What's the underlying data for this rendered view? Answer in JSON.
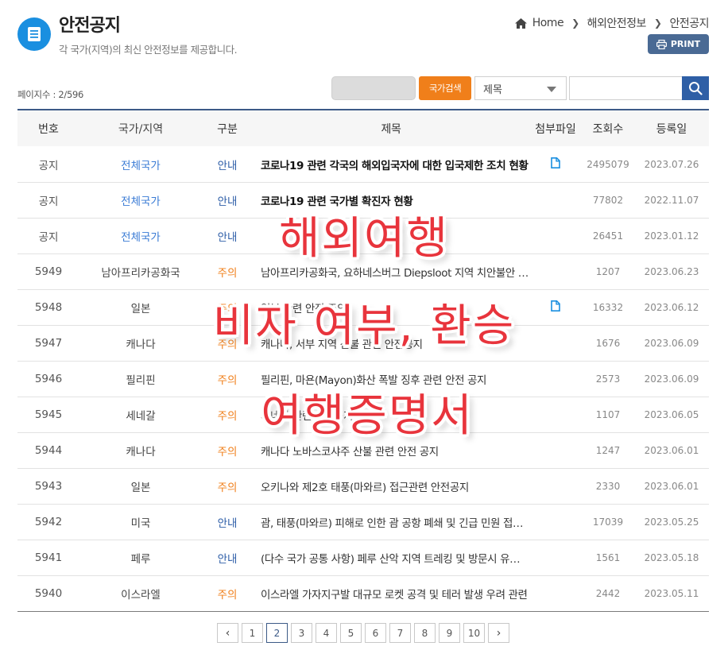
{
  "header": {
    "title": "안전공지",
    "subtitle": "각 국가(지역)의 최신 안전정보를 제공합니다.",
    "breadcrumb": [
      "Home",
      "해외안전정보",
      "안전공지"
    ],
    "print_label": "PRINT"
  },
  "search": {
    "page_count": "페이지수 : 2/596",
    "country_search_label": "국가검색",
    "field_select_value": "제목",
    "keyword_value": ""
  },
  "table": {
    "headers": {
      "no": "번호",
      "country": "국가/지역",
      "type": "구분",
      "title": "제목",
      "file": "첨부파일",
      "views": "조회수",
      "date": "등록일"
    },
    "rows": [
      {
        "no": "공지",
        "country": "전체국가",
        "type": "안내",
        "title": "코로나19 관련 각국의 해외입국자에 대한 입국제한 조치 현황",
        "views": "2495079",
        "date": "2023.07.26",
        "file": true,
        "bold": true
      },
      {
        "no": "공지",
        "country": "전체국가",
        "type": "안내",
        "title": "코로나19 관련 국가별 확진자 현황",
        "views": "77802",
        "date": "2022.11.07",
        "file": false,
        "bold": true
      },
      {
        "no": "공지",
        "country": "전체국가",
        "type": "안내",
        "title": "",
        "views": "26451",
        "date": "2023.01.12",
        "file": false,
        "bold": true
      },
      {
        "no": "5949",
        "country": "남아프리카공화국",
        "type": "주의",
        "title": "남아프리카공화국, 요하네스버그 Diepsloot 지역 치안불안 관련",
        "views": "1207",
        "date": "2023.06.23",
        "file": false,
        "bold": false
      },
      {
        "no": "5948",
        "country": "일본",
        "type": "주의",
        "title": "일본 관련 안전 주의",
        "views": "16332",
        "date": "2023.06.12",
        "file": true,
        "bold": false
      },
      {
        "no": "5947",
        "country": "캐나다",
        "type": "주의",
        "title": "캐나다, 서부 지역 산불 관련 안전공지",
        "views": "1676",
        "date": "2023.06.09",
        "file": false,
        "bold": false
      },
      {
        "no": "5946",
        "country": "필리핀",
        "type": "주의",
        "title": "필리핀, 마욘(Mayon)화산 폭발 징후 관련 안전 공지",
        "views": "2573",
        "date": "2023.06.09",
        "file": false,
        "bold": false
      },
      {
        "no": "5945",
        "country": "세네갈",
        "type": "주의",
        "title": "세네갈 관련 안전공지",
        "views": "1107",
        "date": "2023.06.05",
        "file": false,
        "bold": false
      },
      {
        "no": "5944",
        "country": "캐나다",
        "type": "주의",
        "title": "캐나다 노바스코샤주 산불 관련 안전 공지",
        "views": "1247",
        "date": "2023.06.01",
        "file": false,
        "bold": false
      },
      {
        "no": "5943",
        "country": "일본",
        "type": "주의",
        "title": "오키나와 제2호 태풍(마와르) 접근관련 안전공지",
        "views": "2330",
        "date": "2023.06.01",
        "file": false,
        "bold": false
      },
      {
        "no": "5942",
        "country": "미국",
        "type": "안내",
        "title": "괌, 태풍(마와르) 피해로 인한 괌 공항 폐쇄 및 긴급 민원 접수 안내",
        "views": "17039",
        "date": "2023.05.25",
        "file": false,
        "bold": false
      },
      {
        "no": "5941",
        "country": "페루",
        "type": "안내",
        "title": "(다수 국가 공통 사항) 페루 산악 지역 트레킹 및 방문시 유의사항",
        "views": "1561",
        "date": "2023.05.18",
        "file": false,
        "bold": false
      },
      {
        "no": "5940",
        "country": "이스라엘",
        "type": "주의",
        "title": "이스라엘 가자지구발 대규모 로켓 공격 및 테러 발생 우려 관련",
        "views": "2442",
        "date": "2023.05.11",
        "file": false,
        "bold": false
      }
    ]
  },
  "pagination": {
    "pages": [
      "1",
      "2",
      "3",
      "4",
      "5",
      "6",
      "7",
      "8",
      "9",
      "10"
    ],
    "current": "2",
    "prev": "‹",
    "next": "›"
  },
  "overlay": {
    "line1": "해외여행",
    "line2": "비자 여부, 환승",
    "line3": "여행증명서"
  },
  "colors": {
    "accent_blue": "#1a8fe0",
    "navy": "#3c5a87",
    "orange": "#f07f1a",
    "overlay_red": "#e8343c"
  }
}
